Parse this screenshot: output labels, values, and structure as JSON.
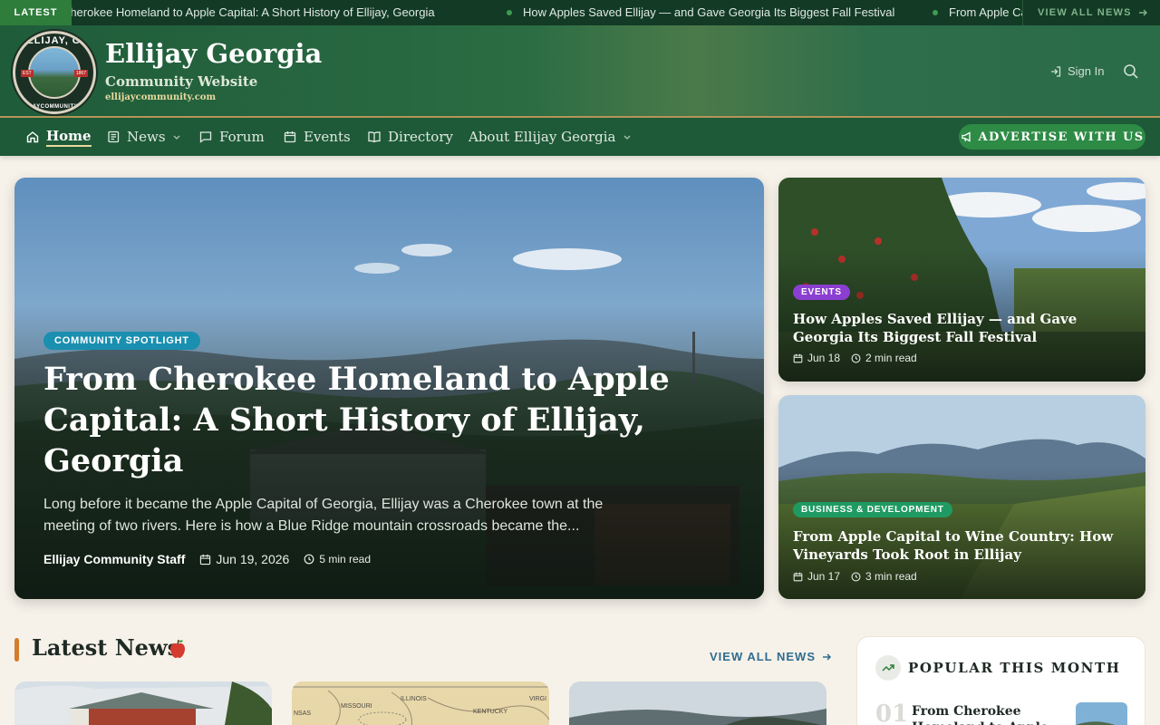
{
  "ticker": {
    "badge": "LATEST",
    "items": [
      "From Cherokee Homeland to Apple Capital: A Short History of Ellijay, Georgia",
      "How Apples Saved Ellijay — and Gave Georgia Its Biggest Fall Festival",
      "From Apple Capital to Wine Country: How Vineyards Took Root in Ellijay"
    ],
    "view_all": "VIEW ALL NEWS"
  },
  "header": {
    "logo_top": "ELLIJAY, GA",
    "logo_bottom": "ELLIJAYCOMMUNITY.COM",
    "logo_est": "EST",
    "logo_year": "1867",
    "title": "Ellijay Georgia",
    "subtitle": "Community Website",
    "url": "ellijaycommunity.com",
    "signin": "Sign In"
  },
  "nav": {
    "items": [
      {
        "label": "Home",
        "icon": "home-icon"
      },
      {
        "label": "News",
        "icon": "newspaper-icon"
      },
      {
        "label": "Forum",
        "icon": "chat-icon"
      },
      {
        "label": "Events",
        "icon": "calendar-icon"
      },
      {
        "label": "Directory",
        "icon": "book-icon"
      },
      {
        "label": "About Ellijay Georgia",
        "icon": ""
      }
    ],
    "advertise": "ADVERTISE WITH US"
  },
  "hero": {
    "tag": "COMMUNITY SPOTLIGHT",
    "title": "From Cherokee Homeland to Apple Capital: A Short History of Ellijay, Georgia",
    "description": "Long before it became the Apple Capital of Georgia, Ellijay was a Cherokee town at the meeting of two rivers. Here is how a Blue Ridge mountain crossroads became the...",
    "author": "Ellijay Community Staff",
    "date": "Jun 19, 2026",
    "read_time": "5 min read"
  },
  "side_cards": [
    {
      "tag": "EVENTS",
      "tag_color": "#8a3fd1",
      "title": "How Apples Saved Ellijay — and Gave Georgia Its Biggest Fall Festival",
      "date": "Jun 18",
      "read_time": "2 min read"
    },
    {
      "tag": "BUSINESS & DEVELOPMENT",
      "tag_color": "#1f9a62",
      "title": "From Apple Capital to Wine Country: How Vineyards Took Root in Ellijay",
      "date": "Jun 17",
      "read_time": "3 min read"
    }
  ],
  "latest": {
    "title": "Latest News",
    "view_all": "VIEW ALL NEWS",
    "map_labels": [
      "MISSOURI",
      "ILLINOIS",
      "KENTUCKY",
      "VIRGI",
      "NSAS"
    ]
  },
  "popular": {
    "title": "POPULAR THIS MONTH",
    "items": [
      {
        "rank": "01",
        "title": "From Cherokee Homeland to Apple"
      }
    ]
  },
  "colors": {
    "brand_green": "#1e5a38",
    "accent_gold": "#b89a5a",
    "spotlight_tag": "#1b8fb0",
    "advertise_button": "#2e8b45"
  }
}
